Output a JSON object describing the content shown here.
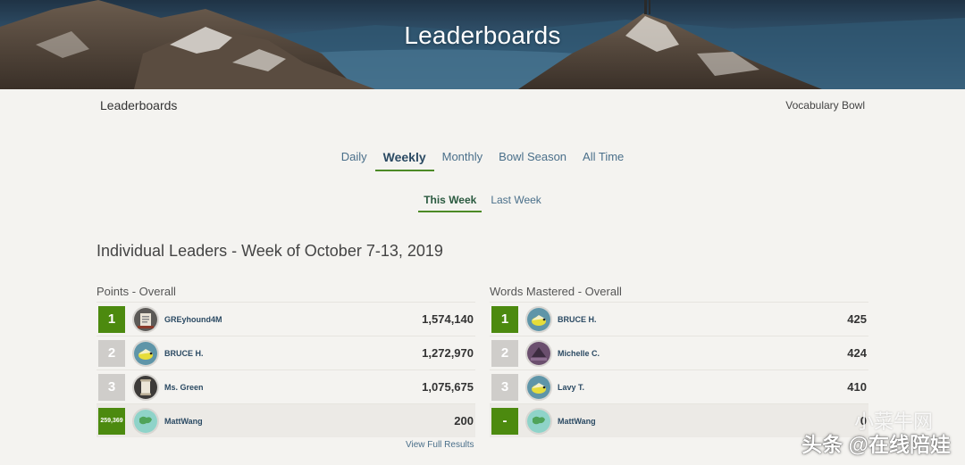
{
  "hero": {
    "title": "Leaderboards"
  },
  "subheader": {
    "left": "Leaderboards",
    "right": "Vocabulary Bowl"
  },
  "period_tabs": [
    {
      "label": "Daily",
      "active": false
    },
    {
      "label": "Weekly",
      "active": true
    },
    {
      "label": "Monthly",
      "active": false
    },
    {
      "label": "Bowl Season",
      "active": false
    },
    {
      "label": "All Time",
      "active": false
    }
  ],
  "week_tabs": [
    {
      "label": "This Week",
      "active": true
    },
    {
      "label": "Last Week",
      "active": false
    }
  ],
  "section_title": "Individual Leaders - Week of October 7-13, 2019",
  "boards": [
    {
      "title": "Points - Overall",
      "rows": [
        {
          "rank": "1",
          "name": "GREyhound4M",
          "score": "1,574,140",
          "avatar": "book-avatar"
        },
        {
          "rank": "2",
          "name": "BRUCE H.",
          "score": "1,272,970",
          "avatar": "bird-avatar"
        },
        {
          "rank": "3",
          "name": "Ms. Green",
          "score": "1,075,675",
          "avatar": "scroll-avatar"
        },
        {
          "rank": "259,369",
          "name": "MattWang",
          "score": "200",
          "avatar": "map-avatar"
        }
      ]
    },
    {
      "title": "Words Mastered - Overall",
      "rows": [
        {
          "rank": "1",
          "name": "BRUCE H.",
          "score": "425",
          "avatar": "bird-avatar"
        },
        {
          "rank": "2",
          "name": "Michelle C.",
          "score": "424",
          "avatar": "shark-avatar"
        },
        {
          "rank": "3",
          "name": "Lavy T.",
          "score": "410",
          "avatar": "bird-avatar"
        },
        {
          "rank": "-",
          "name": "MattWang",
          "score": "0",
          "avatar": "map-avatar"
        }
      ]
    }
  ],
  "view_full": "View Full Results",
  "watermark": {
    "line1": "小菜牛网",
    "line2": "头条 @在线陪娃"
  },
  "colors": {
    "accent_green": "#4c8a0f",
    "link_blue": "#4a6f8a",
    "rank_gray": "#cfcdca"
  }
}
